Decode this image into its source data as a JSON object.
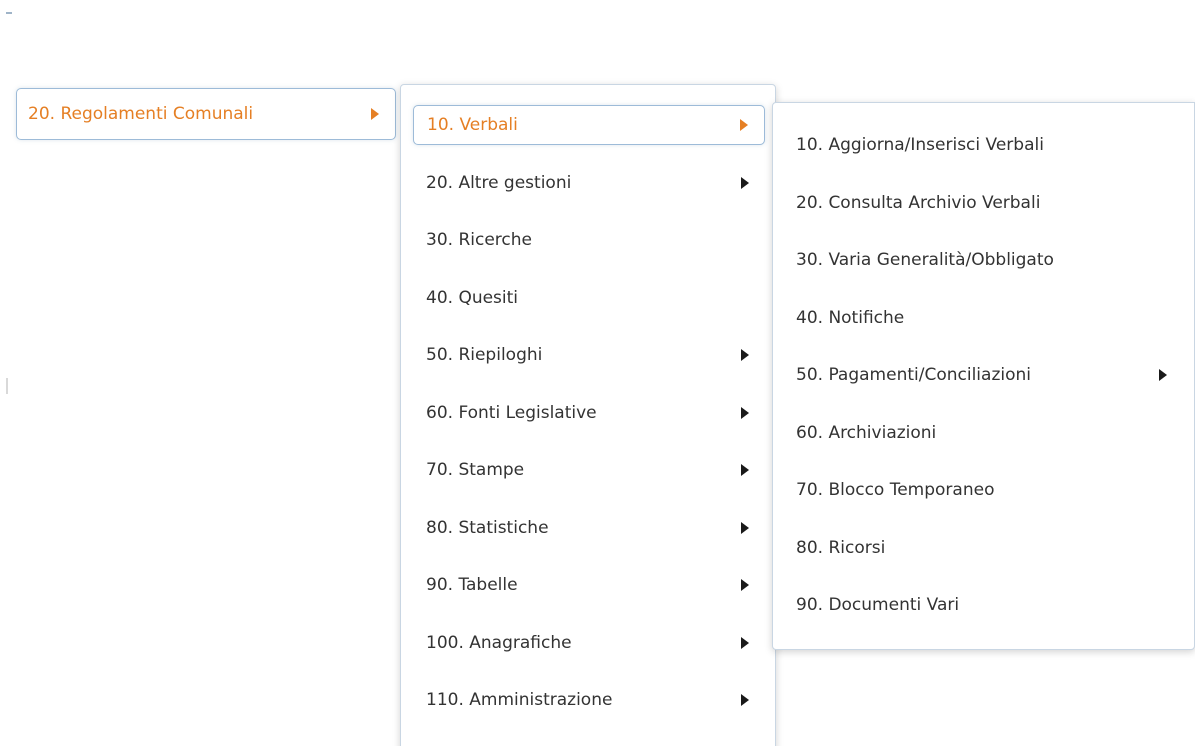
{
  "menu": {
    "level1": {
      "label": "20. Regolamenti Comunali",
      "arrow_icon": "caret-right-icon",
      "active": true
    },
    "level2": [
      {
        "label": "10. Verbali",
        "has_submenu": true,
        "active": true
      },
      {
        "label": "20. Altre gestioni",
        "has_submenu": true
      },
      {
        "label": "30. Ricerche",
        "has_submenu": false
      },
      {
        "label": "40. Quesiti",
        "has_submenu": false
      },
      {
        "label": "50. Riepiloghi",
        "has_submenu": true
      },
      {
        "label": "60. Fonti Legislative",
        "has_submenu": true
      },
      {
        "label": "70. Stampe",
        "has_submenu": true
      },
      {
        "label": "80. Statistiche",
        "has_submenu": true
      },
      {
        "label": "90. Tabelle",
        "has_submenu": true
      },
      {
        "label": "100. Anagrafiche",
        "has_submenu": true
      },
      {
        "label": "110. Amministrazione",
        "has_submenu": true
      }
    ],
    "level3": [
      {
        "label": "10. Aggiorna/Inserisci Verbali",
        "has_submenu": false
      },
      {
        "label": "20. Consulta Archivio Verbali",
        "has_submenu": false
      },
      {
        "label": "30. Varia Generalità/Obbligato",
        "has_submenu": false
      },
      {
        "label": "40. Notifiche",
        "has_submenu": false
      },
      {
        "label": "50. Pagamenti/Conciliazioni",
        "has_submenu": true
      },
      {
        "label": "60. Archiviazioni",
        "has_submenu": false
      },
      {
        "label": "70. Blocco Temporaneo",
        "has_submenu": false
      },
      {
        "label": "80. Ricorsi",
        "has_submenu": false
      },
      {
        "label": "90. Documenti Vari",
        "has_submenu": false
      }
    ]
  },
  "colors": {
    "active_text": "#e57f24",
    "text": "#333333",
    "arrow": "#1a1a1a",
    "active_border": "#9dbbd8"
  }
}
